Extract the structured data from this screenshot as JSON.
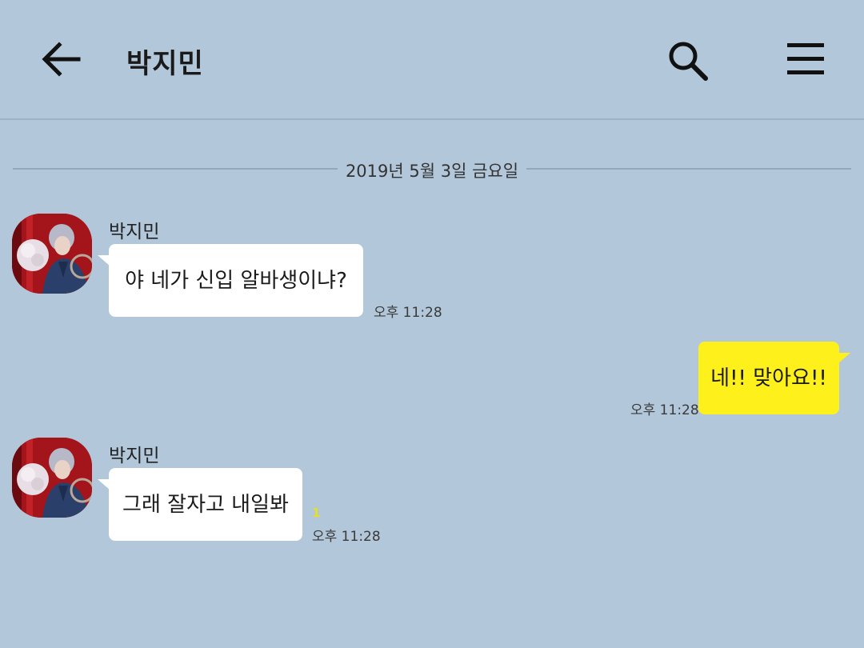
{
  "header": {
    "title": "박지민",
    "back_icon": "arrow-left-icon",
    "search_icon": "search-icon",
    "menu_icon": "hamburger-menu-icon"
  },
  "date_divider": "2019년 5월 3일 금요일",
  "messages": [
    {
      "direction": "incoming",
      "sender": "박지민",
      "text": "야 네가 신입 알바생이냐?",
      "time": "오후 11:28",
      "unread": ""
    },
    {
      "direction": "outgoing",
      "sender": "",
      "text": "네!! 맞아요!!",
      "time": "오후 11:28",
      "unread": ""
    },
    {
      "direction": "incoming",
      "sender": "박지민",
      "text": "그래 잘자고 내일봐",
      "time": "오후 11:28",
      "unread": "1"
    }
  ],
  "colors": {
    "background": "#b2c7da",
    "incoming_bubble": "#ffffff",
    "outgoing_bubble": "#fef01b",
    "unread_count": "#e6e020"
  }
}
